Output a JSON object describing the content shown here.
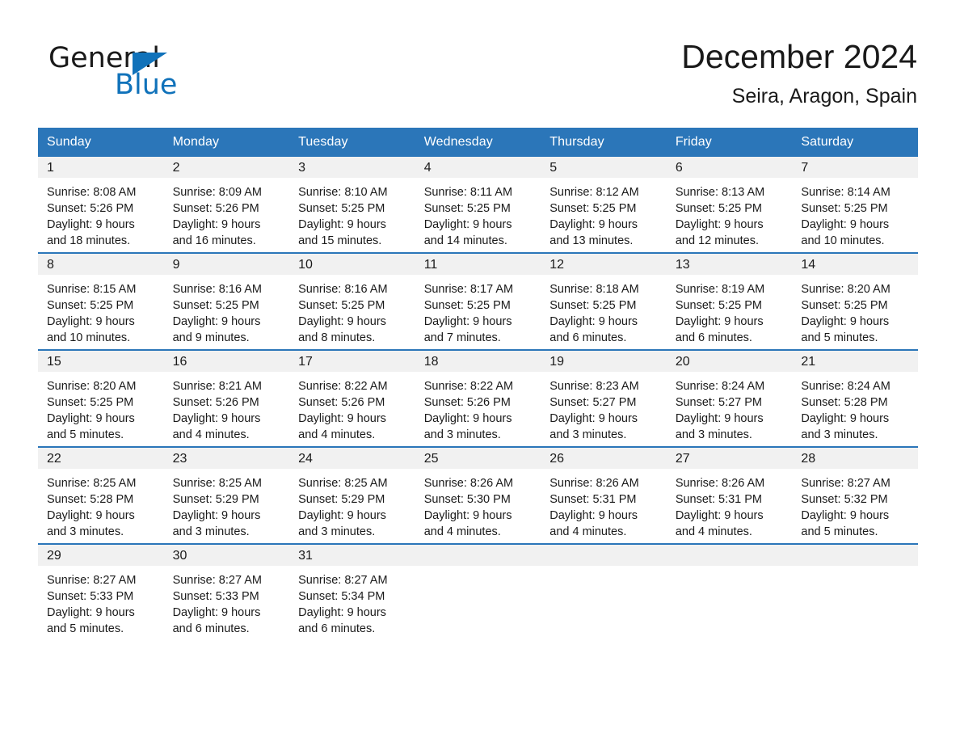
{
  "brand": {
    "name_part1": "General",
    "name_part2": "Blue",
    "triangle_color": "#1072ba"
  },
  "header": {
    "title": "December 2024",
    "subtitle": "Seira, Aragon, Spain",
    "accent_color": "#2b76b9",
    "band_color": "#f1f1f1"
  },
  "weekday_headers": [
    "Sunday",
    "Monday",
    "Tuesday",
    "Wednesday",
    "Thursday",
    "Friday",
    "Saturday"
  ],
  "weeks": [
    [
      {
        "day": "1",
        "sunrise": "Sunrise: 8:08 AM",
        "sunset": "Sunset: 5:26 PM",
        "daylight_line1": "Daylight: 9 hours",
        "daylight_line2": "and 18 minutes."
      },
      {
        "day": "2",
        "sunrise": "Sunrise: 8:09 AM",
        "sunset": "Sunset: 5:26 PM",
        "daylight_line1": "Daylight: 9 hours",
        "daylight_line2": "and 16 minutes."
      },
      {
        "day": "3",
        "sunrise": "Sunrise: 8:10 AM",
        "sunset": "Sunset: 5:25 PM",
        "daylight_line1": "Daylight: 9 hours",
        "daylight_line2": "and 15 minutes."
      },
      {
        "day": "4",
        "sunrise": "Sunrise: 8:11 AM",
        "sunset": "Sunset: 5:25 PM",
        "daylight_line1": "Daylight: 9 hours",
        "daylight_line2": "and 14 minutes."
      },
      {
        "day": "5",
        "sunrise": "Sunrise: 8:12 AM",
        "sunset": "Sunset: 5:25 PM",
        "daylight_line1": "Daylight: 9 hours",
        "daylight_line2": "and 13 minutes."
      },
      {
        "day": "6",
        "sunrise": "Sunrise: 8:13 AM",
        "sunset": "Sunset: 5:25 PM",
        "daylight_line1": "Daylight: 9 hours",
        "daylight_line2": "and 12 minutes."
      },
      {
        "day": "7",
        "sunrise": "Sunrise: 8:14 AM",
        "sunset": "Sunset: 5:25 PM",
        "daylight_line1": "Daylight: 9 hours",
        "daylight_line2": "and 10 minutes."
      }
    ],
    [
      {
        "day": "8",
        "sunrise": "Sunrise: 8:15 AM",
        "sunset": "Sunset: 5:25 PM",
        "daylight_line1": "Daylight: 9 hours",
        "daylight_line2": "and 10 minutes."
      },
      {
        "day": "9",
        "sunrise": "Sunrise: 8:16 AM",
        "sunset": "Sunset: 5:25 PM",
        "daylight_line1": "Daylight: 9 hours",
        "daylight_line2": "and 9 minutes."
      },
      {
        "day": "10",
        "sunrise": "Sunrise: 8:16 AM",
        "sunset": "Sunset: 5:25 PM",
        "daylight_line1": "Daylight: 9 hours",
        "daylight_line2": "and 8 minutes."
      },
      {
        "day": "11",
        "sunrise": "Sunrise: 8:17 AM",
        "sunset": "Sunset: 5:25 PM",
        "daylight_line1": "Daylight: 9 hours",
        "daylight_line2": "and 7 minutes."
      },
      {
        "day": "12",
        "sunrise": "Sunrise: 8:18 AM",
        "sunset": "Sunset: 5:25 PM",
        "daylight_line1": "Daylight: 9 hours",
        "daylight_line2": "and 6 minutes."
      },
      {
        "day": "13",
        "sunrise": "Sunrise: 8:19 AM",
        "sunset": "Sunset: 5:25 PM",
        "daylight_line1": "Daylight: 9 hours",
        "daylight_line2": "and 6 minutes."
      },
      {
        "day": "14",
        "sunrise": "Sunrise: 8:20 AM",
        "sunset": "Sunset: 5:25 PM",
        "daylight_line1": "Daylight: 9 hours",
        "daylight_line2": "and 5 minutes."
      }
    ],
    [
      {
        "day": "15",
        "sunrise": "Sunrise: 8:20 AM",
        "sunset": "Sunset: 5:25 PM",
        "daylight_line1": "Daylight: 9 hours",
        "daylight_line2": "and 5 minutes."
      },
      {
        "day": "16",
        "sunrise": "Sunrise: 8:21 AM",
        "sunset": "Sunset: 5:26 PM",
        "daylight_line1": "Daylight: 9 hours",
        "daylight_line2": "and 4 minutes."
      },
      {
        "day": "17",
        "sunrise": "Sunrise: 8:22 AM",
        "sunset": "Sunset: 5:26 PM",
        "daylight_line1": "Daylight: 9 hours",
        "daylight_line2": "and 4 minutes."
      },
      {
        "day": "18",
        "sunrise": "Sunrise: 8:22 AM",
        "sunset": "Sunset: 5:26 PM",
        "daylight_line1": "Daylight: 9 hours",
        "daylight_line2": "and 3 minutes."
      },
      {
        "day": "19",
        "sunrise": "Sunrise: 8:23 AM",
        "sunset": "Sunset: 5:27 PM",
        "daylight_line1": "Daylight: 9 hours",
        "daylight_line2": "and 3 minutes."
      },
      {
        "day": "20",
        "sunrise": "Sunrise: 8:24 AM",
        "sunset": "Sunset: 5:27 PM",
        "daylight_line1": "Daylight: 9 hours",
        "daylight_line2": "and 3 minutes."
      },
      {
        "day": "21",
        "sunrise": "Sunrise: 8:24 AM",
        "sunset": "Sunset: 5:28 PM",
        "daylight_line1": "Daylight: 9 hours",
        "daylight_line2": "and 3 minutes."
      }
    ],
    [
      {
        "day": "22",
        "sunrise": "Sunrise: 8:25 AM",
        "sunset": "Sunset: 5:28 PM",
        "daylight_line1": "Daylight: 9 hours",
        "daylight_line2": "and 3 minutes."
      },
      {
        "day": "23",
        "sunrise": "Sunrise: 8:25 AM",
        "sunset": "Sunset: 5:29 PM",
        "daylight_line1": "Daylight: 9 hours",
        "daylight_line2": "and 3 minutes."
      },
      {
        "day": "24",
        "sunrise": "Sunrise: 8:25 AM",
        "sunset": "Sunset: 5:29 PM",
        "daylight_line1": "Daylight: 9 hours",
        "daylight_line2": "and 3 minutes."
      },
      {
        "day": "25",
        "sunrise": "Sunrise: 8:26 AM",
        "sunset": "Sunset: 5:30 PM",
        "daylight_line1": "Daylight: 9 hours",
        "daylight_line2": "and 4 minutes."
      },
      {
        "day": "26",
        "sunrise": "Sunrise: 8:26 AM",
        "sunset": "Sunset: 5:31 PM",
        "daylight_line1": "Daylight: 9 hours",
        "daylight_line2": "and 4 minutes."
      },
      {
        "day": "27",
        "sunrise": "Sunrise: 8:26 AM",
        "sunset": "Sunset: 5:31 PM",
        "daylight_line1": "Daylight: 9 hours",
        "daylight_line2": "and 4 minutes."
      },
      {
        "day": "28",
        "sunrise": "Sunrise: 8:27 AM",
        "sunset": "Sunset: 5:32 PM",
        "daylight_line1": "Daylight: 9 hours",
        "daylight_line2": "and 5 minutes."
      }
    ],
    [
      {
        "day": "29",
        "sunrise": "Sunrise: 8:27 AM",
        "sunset": "Sunset: 5:33 PM",
        "daylight_line1": "Daylight: 9 hours",
        "daylight_line2": "and 5 minutes."
      },
      {
        "day": "30",
        "sunrise": "Sunrise: 8:27 AM",
        "sunset": "Sunset: 5:33 PM",
        "daylight_line1": "Daylight: 9 hours",
        "daylight_line2": "and 6 minutes."
      },
      {
        "day": "31",
        "sunrise": "Sunrise: 8:27 AM",
        "sunset": "Sunset: 5:34 PM",
        "daylight_line1": "Daylight: 9 hours",
        "daylight_line2": "and 6 minutes."
      },
      {
        "day": "",
        "sunrise": "",
        "sunset": "",
        "daylight_line1": "",
        "daylight_line2": ""
      },
      {
        "day": "",
        "sunrise": "",
        "sunset": "",
        "daylight_line1": "",
        "daylight_line2": ""
      },
      {
        "day": "",
        "sunrise": "",
        "sunset": "",
        "daylight_line1": "",
        "daylight_line2": ""
      },
      {
        "day": "",
        "sunrise": "",
        "sunset": "",
        "daylight_line1": "",
        "daylight_line2": ""
      }
    ]
  ]
}
